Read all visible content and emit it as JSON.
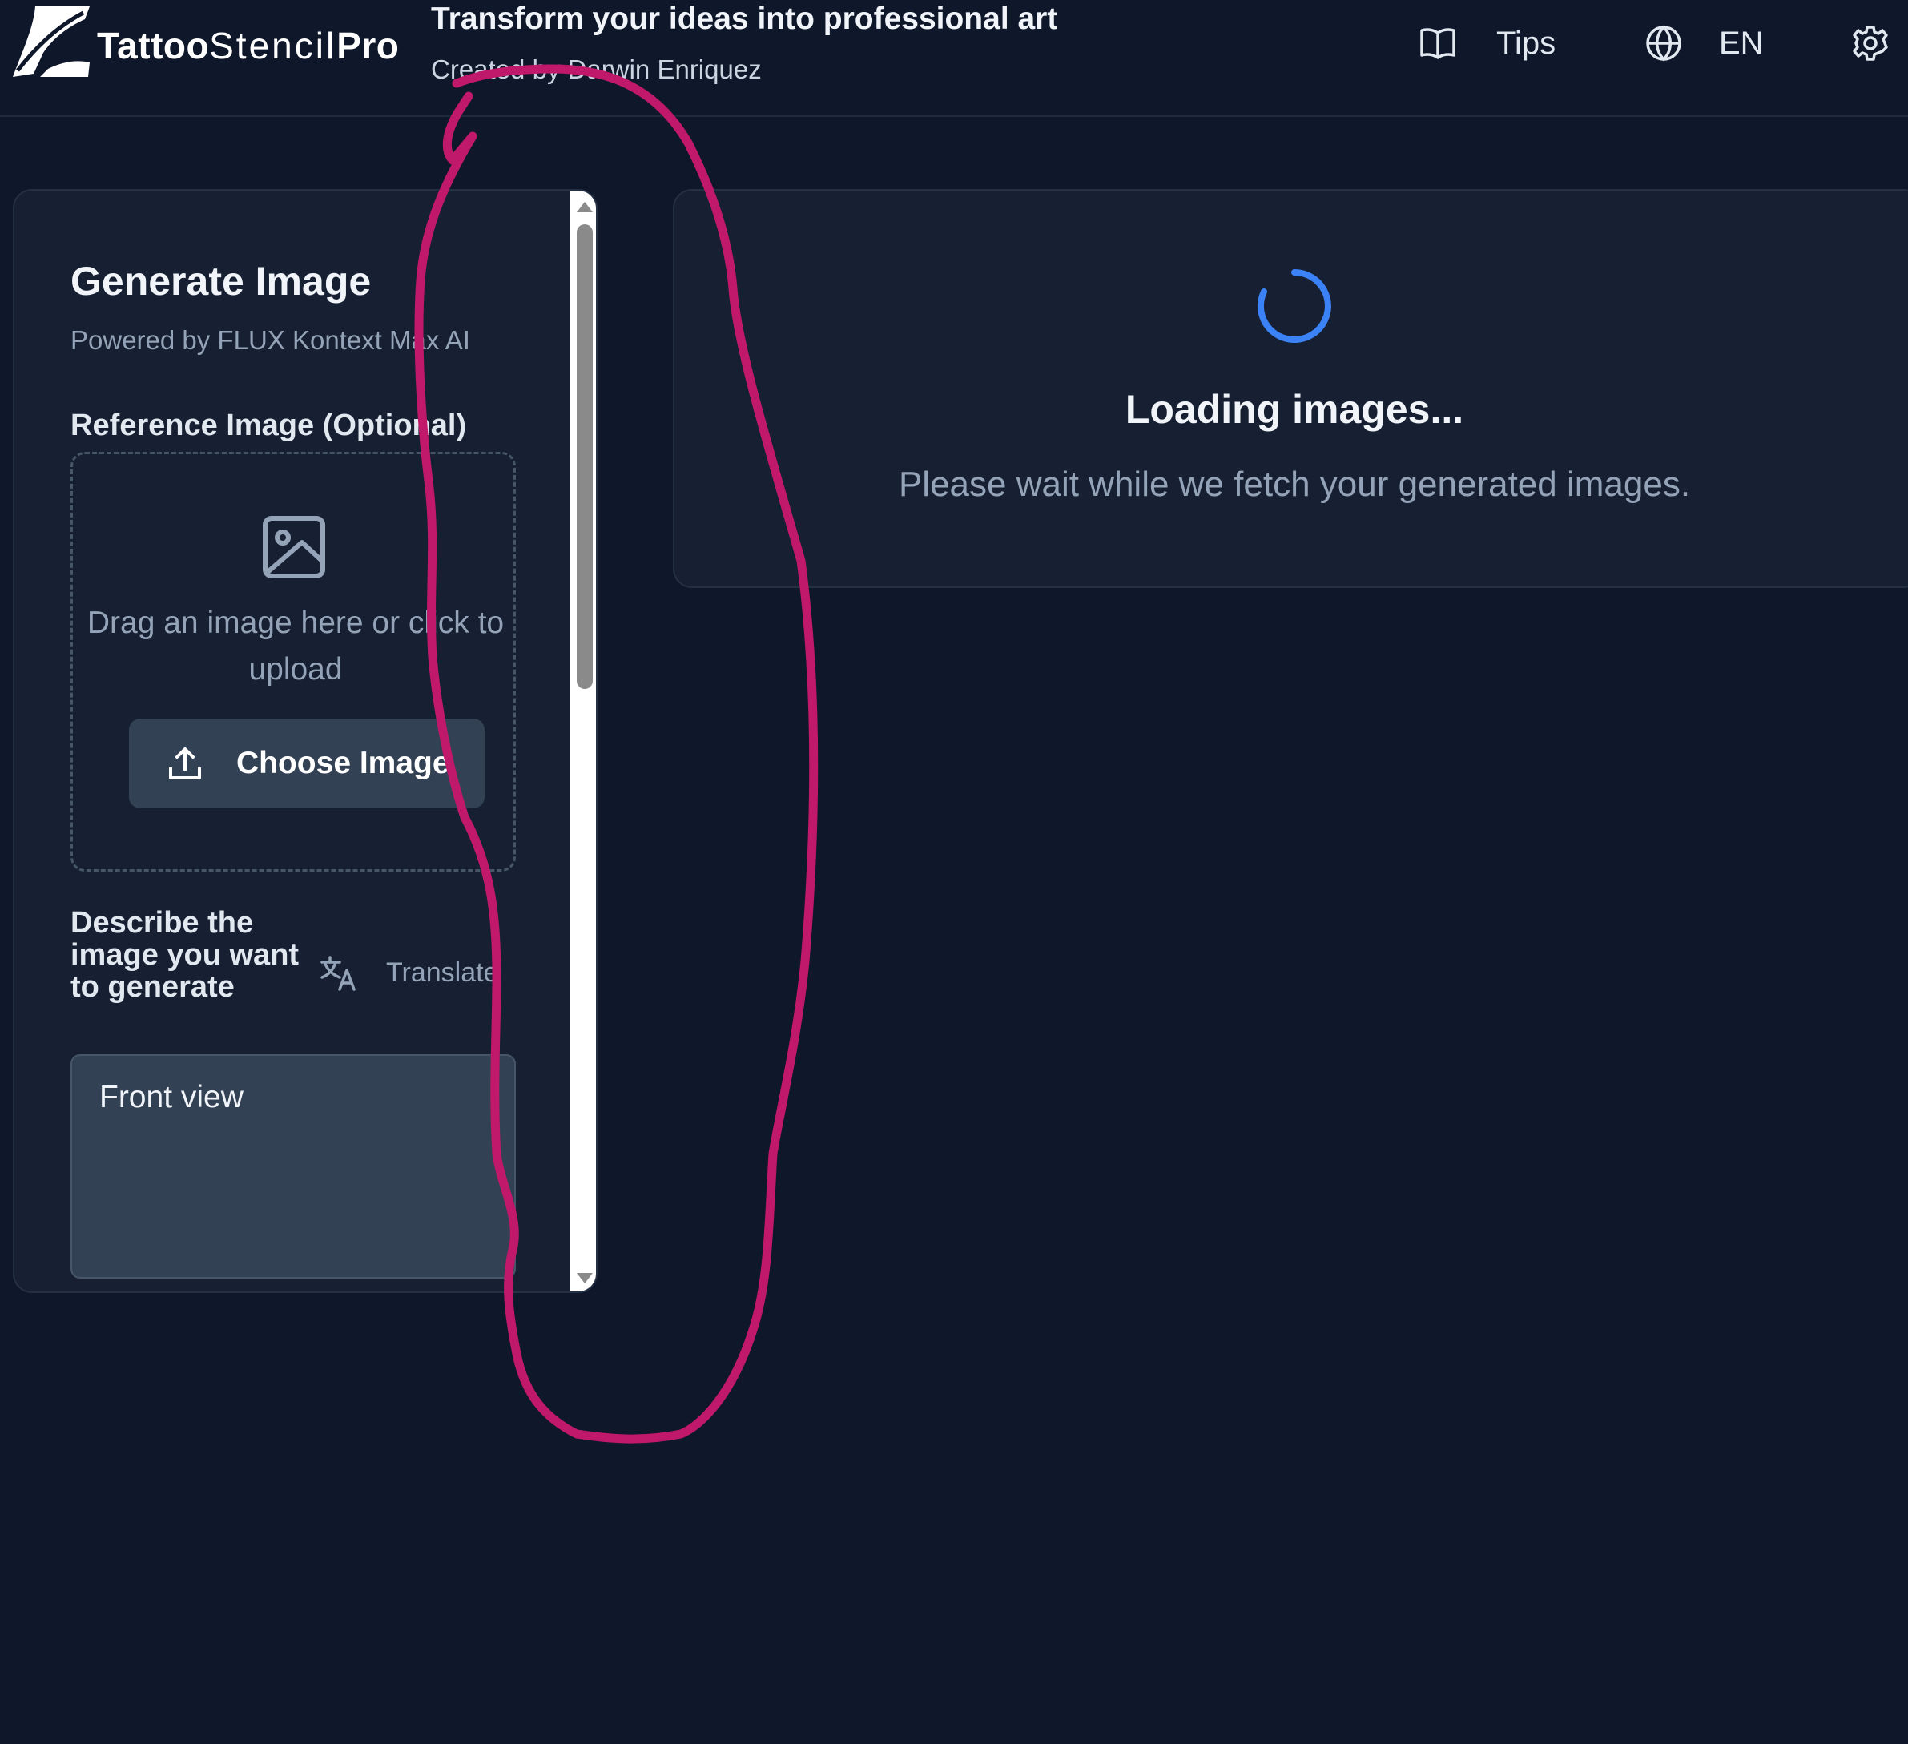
{
  "header": {
    "logo_bold_1": "Tattoo",
    "logo_thin": "Stencil",
    "logo_bold_2": "Pro",
    "tagline": "Transform your ideas into professional art",
    "credit": "Created by Darwin Enriquez",
    "tips_label": "Tips",
    "tips_icon": "book-icon",
    "language_label": "EN",
    "language_icon": "globe-icon",
    "settings_icon": "gear-icon"
  },
  "generator": {
    "title": "Generate Image",
    "subtitle": "Powered by FLUX Kontext Max AI",
    "reference_label": "Reference Image (Optional)",
    "dropzone_text": "Drag an image here or click to upload",
    "dropzone_icon": "image-icon",
    "choose_button": "Choose Image",
    "choose_icon": "upload-icon",
    "description_label": "Describe the image you want to generate",
    "translate_label": "Translate",
    "translate_icon": "translate-icon",
    "prompt_value": "Front view"
  },
  "results": {
    "loading_title": "Loading images...",
    "loading_message": "Please wait while we fetch your generated images.",
    "spinner_icon": "spinner-icon"
  },
  "colors": {
    "background": "#0f172a",
    "panel": "#172033",
    "spinner": "#3b82f6",
    "annotation": "#c0186a"
  }
}
